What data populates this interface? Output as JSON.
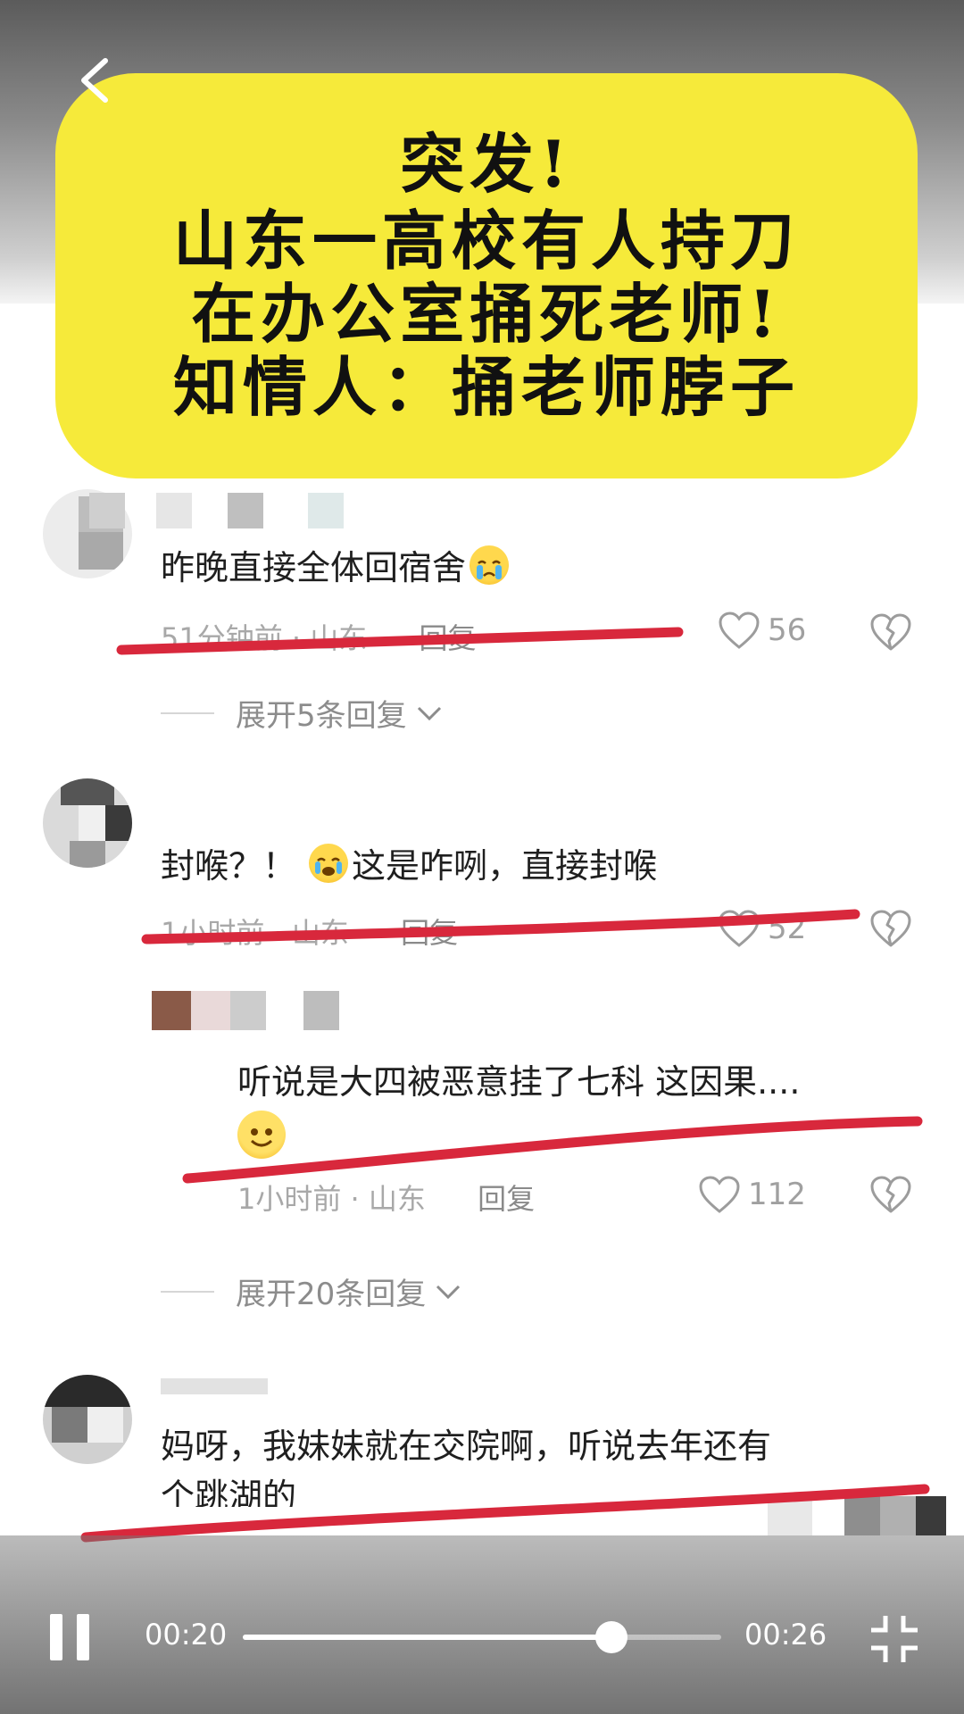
{
  "headline": {
    "lines": [
      "突发!",
      "山东一高校有人持刀",
      "在办公室捅死老师!",
      "知情人：捅老师脖子"
    ]
  },
  "comments": [
    {
      "text": "昨晚直接全体回宿舍",
      "emoji_icon": "crying-face-emoji",
      "time": "51分钟前",
      "sep": "·",
      "location": "山东",
      "reply_label": "回复",
      "likes": "56",
      "expand_label": "展开5条回复"
    },
    {
      "text_before_emoji": "封喉？！",
      "emoji_icon": "crying-face-emoji",
      "text_after_emoji": "这是咋咧，直接封喉",
      "time": "1小时前",
      "sep": "·",
      "location": "山东",
      "reply_label": "回复",
      "likes": "52"
    },
    {
      "text": "听说是大四被恶意挂了七科 这因果....",
      "emoji_icon": "smiling-face-emoji",
      "time": "1小时前",
      "sep": "·",
      "location": "山东",
      "reply_label": "回复",
      "likes": "112",
      "expand_label": "展开20条回复"
    },
    {
      "text_line1": "妈呀，我妹妹就在交院啊，听说去年还有",
      "text_line2": "个跳湖的"
    }
  ],
  "player": {
    "current_time": "00:20",
    "total_time": "00:26",
    "progress": 0.77,
    "play_state_icon": "pause-icon",
    "fullscreen_icon": "exit-fullscreen-icon"
  },
  "colors": {
    "headline_bg": "#f6ea3a",
    "underline": "#d8283c",
    "meta_text": "#a8a8a8"
  }
}
